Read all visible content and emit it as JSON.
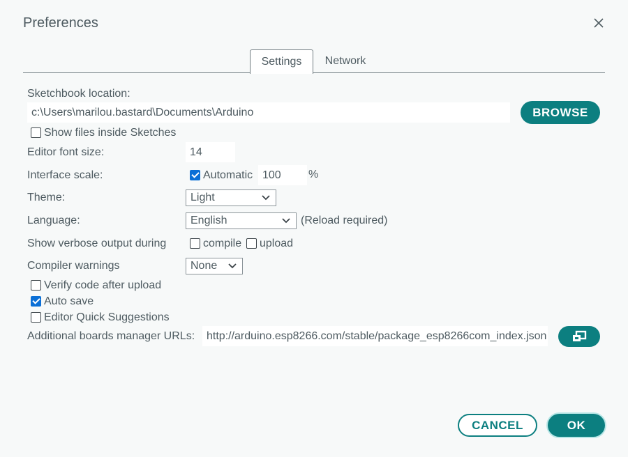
{
  "dialog": {
    "title": "Preferences"
  },
  "tabs": [
    {
      "label": "Settings",
      "active": true
    },
    {
      "label": "Network",
      "active": false
    }
  ],
  "settings": {
    "sketchbook_label": "Sketchbook location:",
    "sketchbook_path": "c:\\Users\\marilou.bastard\\Documents\\Arduino",
    "browse_label": "BROWSE",
    "show_files_label": "Show files inside Sketches",
    "show_files_checked": false,
    "font_size_label": "Editor font size:",
    "font_size_value": "14",
    "interface_scale_label": "Interface scale:",
    "automatic_label": "Automatic",
    "automatic_checked": true,
    "scale_value": "100",
    "scale_unit": "%",
    "theme_label": "Theme:",
    "theme_value": "Light",
    "language_label": "Language:",
    "language_value": "English",
    "reload_note": "(Reload required)",
    "verbose_label": "Show verbose output during",
    "compile_label": "compile",
    "compile_checked": false,
    "upload_label": "upload",
    "upload_checked": false,
    "warnings_label": "Compiler warnings",
    "warnings_value": "None",
    "verify_label": "Verify code after upload",
    "verify_checked": false,
    "autosave_label": "Auto save",
    "autosave_checked": true,
    "quick_suggestions_label": "Editor Quick Suggestions",
    "quick_suggestions_checked": false,
    "boards_urls_label": "Additional boards manager URLs:",
    "boards_urls_value": "http://arduino.esp8266.com/stable/package_esp8266com_index.json"
  },
  "footer": {
    "cancel_label": "CANCEL",
    "ok_label": "OK"
  },
  "colors": {
    "accent": "#0c7f80",
    "checkbox": "#0b6fd6",
    "text": "#4e5b61",
    "background": "#f7f9f9"
  },
  "icons": {
    "close": "close-icon",
    "open_window": "open-window-icon",
    "dropdown": "chevron-down-icon"
  }
}
